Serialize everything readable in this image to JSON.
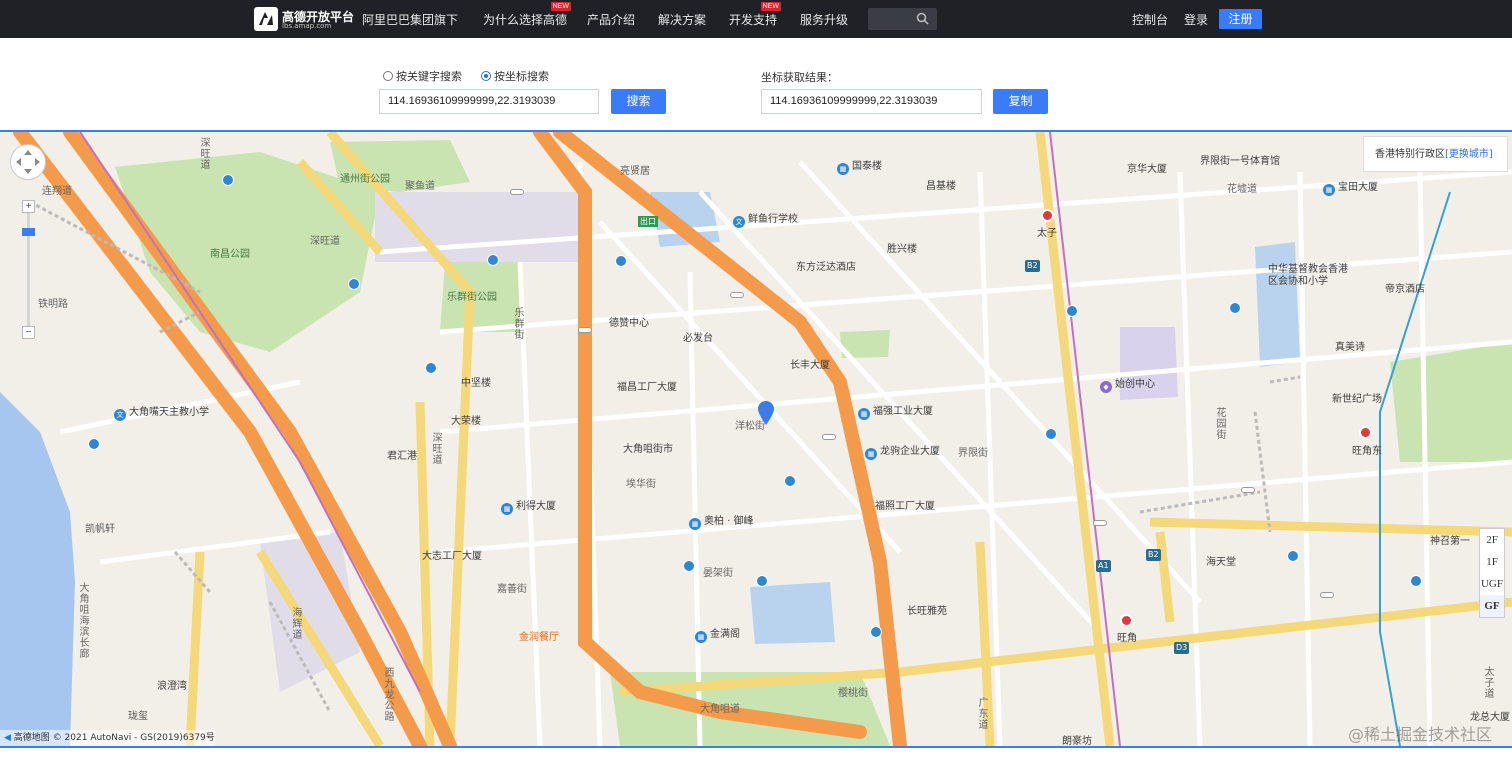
{
  "nav": {
    "logo_name": "高德开放平台",
    "logo_sub": "lbs.amap.com",
    "items": [
      {
        "label": "阿里巴巴集团旗下",
        "new": ""
      },
      {
        "label": "为什么选择高德",
        "new": "NEW"
      },
      {
        "label": "产品介绍",
        "new": ""
      },
      {
        "label": "解决方案",
        "new": ""
      },
      {
        "label": "开发支持",
        "new": "NEW"
      },
      {
        "label": "服务升级",
        "new": ""
      }
    ],
    "console": "控制台",
    "login": "登录",
    "register": "注册"
  },
  "form": {
    "radio_keyword": "按关键字搜索",
    "radio_coord": "按坐标搜索",
    "selected_mode": "按坐标搜索",
    "coord_input_value": "114.16936109999999,22.3193039",
    "search_btn": "搜索",
    "result_label": "坐标获取结果：",
    "result_value": "114.16936109999999,22.3193039",
    "copy_btn": "复制"
  },
  "map": {
    "city": "香港特别行政区",
    "change_city": "[更换城市]",
    "floors": [
      "2F",
      "1F",
      "UGF",
      "GF"
    ],
    "active_floor": "GF",
    "copyright_logo": "高德地图",
    "copyright": "© 2021 AutoNavi - GS(2019)6379号",
    "watermark": "@稀土掘金技术社区",
    "labels": {
      "tongzhoujie_park": "通州街公园",
      "jujing_dao": "聚鱼道",
      "shenwang_dao1": "深旺道",
      "shenwang_dao2": "深旺道",
      "shenwang_dao3": "深旺道",
      "lianxiang_dao": "连翔道",
      "nanchang_park": "南昌公园",
      "tieming_lu": "铁明路",
      "lequn_park": "乐群街公园",
      "lequn_jie": "乐群街",
      "liangxian_ju": "亮贤居",
      "guotai_lou": "国泰楼",
      "changji_lou": "昌基楼",
      "xianyu_school": "鲜鱼行学校",
      "shengxing_lou": "胜兴楼",
      "dongfang_hotel": "东方泛达酒店",
      "dexian_center": "德赞中心",
      "bifadai": "必发台",
      "changfeng": "长丰大厦",
      "zhongjian_lou": "中坚楼",
      "fuchang": "福昌工厂大厦",
      "dajiaozui_school": "大角嘴天主教小学",
      "darong_lou": "大荣楼",
      "junhui_gang": "君汇港",
      "dajiaozui_market": "大角咀街市",
      "yangsong_jie": "洋松街",
      "fuqiang": "福强工业大厦",
      "longju": "龙驹企业大厦",
      "hua_jie": "埃华街",
      "lide": "利得大厦",
      "futang": "福照工厂大厦",
      "aobai": "奥柏 · 御峰",
      "kaifan_xuan": "凯帆轩",
      "dazhi": "大志工厂大厦",
      "jiashan_jie": "嘉善街",
      "yanjia_jie": "晏架街",
      "jinrun": "金润餐厅",
      "jinman_ge": "金满阁",
      "changwang_yayuan": "长旺雅苑",
      "langao_wan": "浪澄湾",
      "longxi": "珑玺",
      "dajiaozui_dao": "大角咀道",
      "yingtao_jie": "樱桃街",
      "guangdong_dao": "广东道",
      "langhao_fang": "朗豪坊",
      "xijiulong": "西九龙公路",
      "jiexian_tiyu": "界限街一号体育馆",
      "jinghua": "京华大厦",
      "baotian": "宝田大厦",
      "huaxu_dao": "花墟道",
      "taizi": "太子",
      "zhonghua": "中华基督教会香港区会协和小学",
      "dijing": "帝京酒店",
      "zhenmei": "真美诗",
      "shizhi_center": "始创中心",
      "xinshiji": "新世纪广场",
      "wangjiao_dong": "旺角东",
      "huayuan_jie": "花园街",
      "haitian_tang": "海天堂",
      "wangjiao": "旺角",
      "shendiao": "神召第一",
      "taizi_dao": "太子道",
      "longxing": "龙总大厦",
      "chukou": "出口",
      "jiexian": "界限街",
      "dajiaozui_haibin": "大角咀海滨长廊",
      "haijie": "海辉道",
      "shenwang_dao4": "深旺道"
    }
  }
}
